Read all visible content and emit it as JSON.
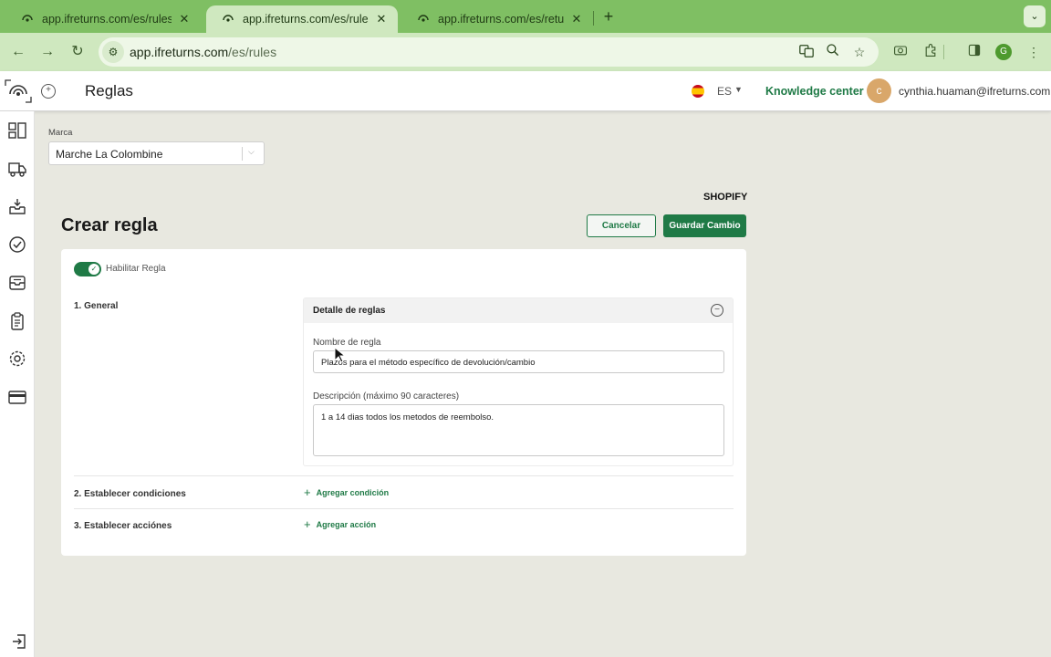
{
  "browser": {
    "tabs": [
      {
        "title": "app.ifreturns.com/es/rules",
        "close": "✕"
      },
      {
        "title": "app.ifreturns.com/es/rules",
        "close": "✕"
      },
      {
        "title": "app.ifreturns.com/es/return-p",
        "close": "✕"
      }
    ],
    "new_tab": "+",
    "url_host": "app.ifreturns.com",
    "url_path": "/es/rules",
    "profile_initial": "G"
  },
  "header": {
    "title": "Reglas",
    "language": "ES",
    "knowledge_center": "Knowledge center",
    "avatar_initial": "c",
    "user_email": "cynthia.huaman@ifreturns.com"
  },
  "brand": {
    "label": "Marca",
    "value": "Marche La Colombine"
  },
  "page": {
    "platform": "SHOPIFY",
    "heading": "Crear regla",
    "cancel": "Cancelar",
    "save": "Guardar Cambio"
  },
  "rule": {
    "enable_label": "Habilitar Regla",
    "enabled": true,
    "section_general": "1. General",
    "section_conditions": "2. Establecer condiciones",
    "section_actions": "3. Establecer acciónes",
    "detail_title": "Detalle de reglas",
    "name_label": "Nombre de regla",
    "name_value": "Plazos para el método específico de devolución/cambio",
    "desc_label": "Descripción (máximo 90 caracteres)",
    "desc_value": "1 a 14 dias todos los metodos de reembolso.",
    "add_condition": "Agregar condición",
    "add_action": "Agregar acción"
  },
  "colors": {
    "accent": "#1f7a46",
    "browser_frame": "#7fbf63",
    "background": "#e8e8e0"
  },
  "icons": {
    "sidebar": [
      "dashboard-icon",
      "truck-icon",
      "inbox-download-icon",
      "check-circle-icon",
      "archive-icon",
      "clipboard-icon",
      "gear-icon",
      "credit-card-icon"
    ]
  }
}
